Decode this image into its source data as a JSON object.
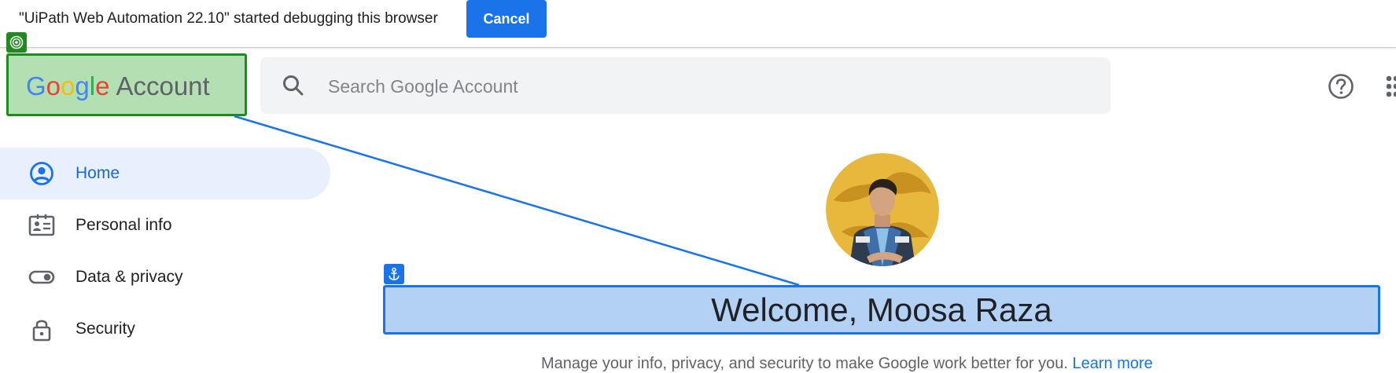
{
  "infobar": {
    "message": "\"UiPath Web Automation 22.10\" started debugging this browser",
    "cancel_label": "Cancel"
  },
  "header": {
    "logo_letters": [
      "G",
      "o",
      "o",
      "g",
      "l",
      "e"
    ],
    "logo_suffix": "Account",
    "search_placeholder": "Search Google Account"
  },
  "sidebar": {
    "items": [
      {
        "label": "Home",
        "icon": "account-circle-icon",
        "active": true
      },
      {
        "label": "Personal info",
        "icon": "id-card-icon",
        "active": false
      },
      {
        "label": "Data & privacy",
        "icon": "toggle-icon",
        "active": false
      },
      {
        "label": "Security",
        "icon": "lock-icon",
        "active": false
      }
    ]
  },
  "main": {
    "welcome": "Welcome, Moosa Raza",
    "subtitle": "Manage your info, privacy, and security to make Google work better for you.",
    "learn_more": "Learn more"
  },
  "colors": {
    "brand_blue": "#1a73e8",
    "active_nav_bg": "#e8f0fe",
    "highlight_green": "#1f8a1f",
    "highlight_green_fill": "#b3dfb3",
    "highlight_blue_fill": "#b3d1f5"
  }
}
